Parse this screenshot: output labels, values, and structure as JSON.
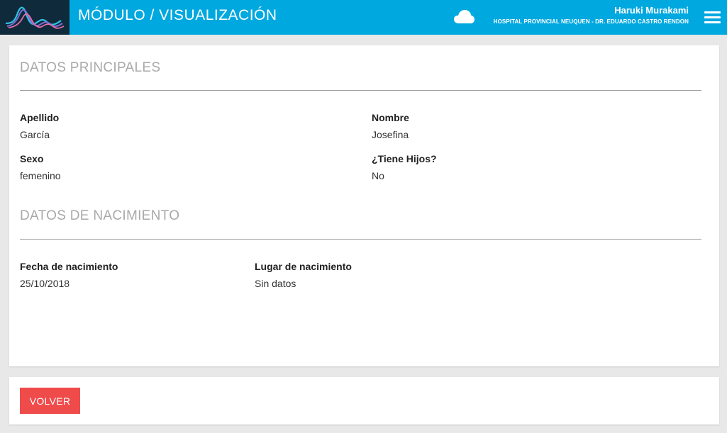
{
  "header": {
    "title": "MÓDULO / VISUALIZACIÓN",
    "user_name": "Haruki Murakami",
    "organization": "HOSPITAL PROVINCIAL NEUQUEN - DR. EDUARDO CASTRO RENDON",
    "icons": [
      "logo",
      "cloud-icon",
      "menu-icon"
    ],
    "colors": {
      "bar": "#00a8e0",
      "logo_bg": "#0f2a3a"
    }
  },
  "datos_principales": {
    "title": "DATOS PRINCIPALES",
    "fields": {
      "apellido": {
        "label": "Apellido",
        "value": "García"
      },
      "nombre": {
        "label": "Nombre",
        "value": "Josefina"
      },
      "sexo": {
        "label": "Sexo",
        "value": "femenino"
      },
      "hijos": {
        "label": "¿Tiene Hijos?",
        "value": "No"
      }
    }
  },
  "datos_nacimiento": {
    "title": "DATOS DE NACIMIENTO",
    "fields": {
      "fecha": {
        "label": "Fecha de nacimiento",
        "value": "25/10/2018"
      },
      "lugar": {
        "label": "Lugar de nacimiento",
        "value": "Sin datos"
      }
    }
  },
  "footer": {
    "back_label": "VOLVER",
    "colors": {
      "button": "#f04b4b"
    }
  }
}
